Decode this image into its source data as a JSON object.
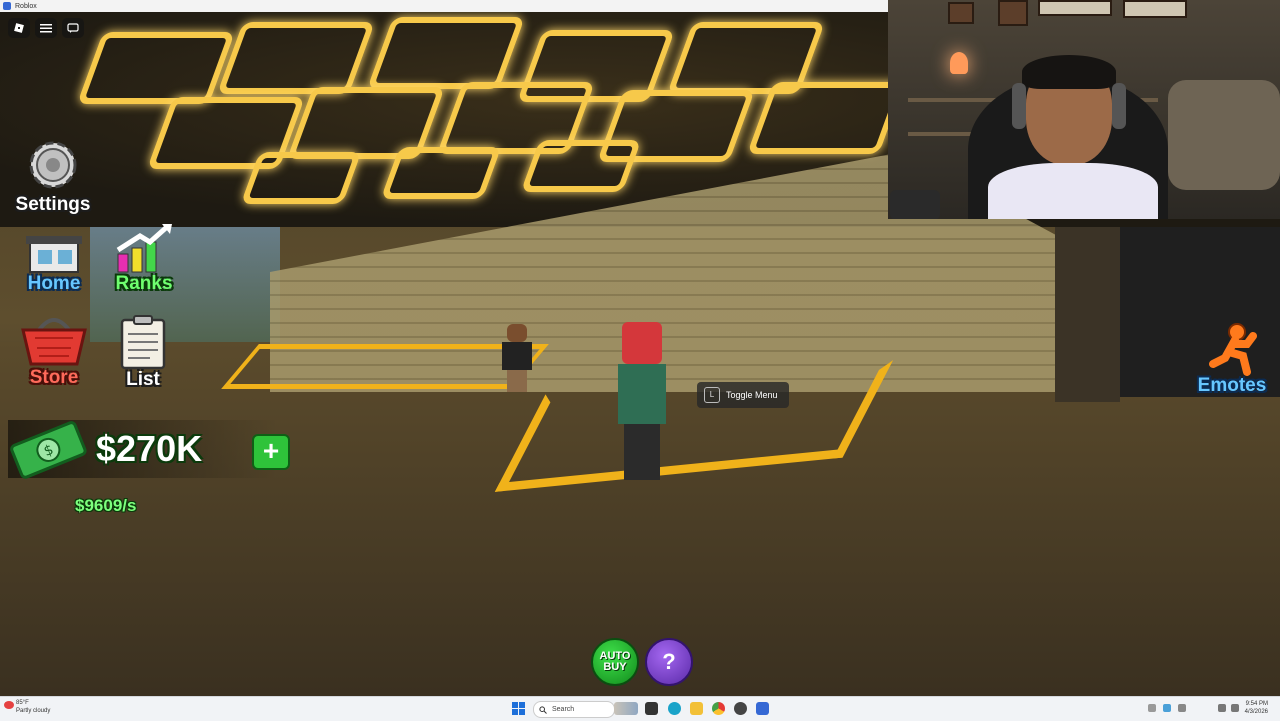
{
  "window": {
    "title": "Roblox"
  },
  "hud": {
    "settings_label": "Settings",
    "home_label": "Home",
    "ranks_label": "Ranks",
    "store_label": "Store",
    "list_label": "List",
    "emotes_label": "Emotes",
    "money": "$270K",
    "money_rate": "$9609/s",
    "plus_label": "+",
    "toggle_menu_key": "L",
    "toggle_menu_label": "Toggle Menu",
    "auto_buy_label": "AUTO BUY",
    "help_label": "?"
  },
  "taskbar": {
    "weather_temp": "85°F",
    "weather_desc": "Partly cloudy",
    "search_placeholder": "Search",
    "time": "9:54 PM",
    "date": "4/3/2026"
  },
  "colors": {
    "parking_lines": "#f0b21a",
    "ceiling_lights": "#f7c94a",
    "money_green": "#2ec33a",
    "help_purple": "#7a42cc"
  }
}
